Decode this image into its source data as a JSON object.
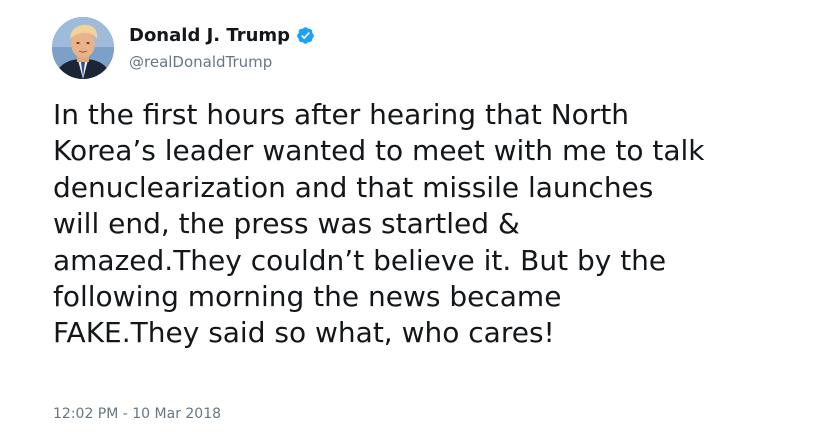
{
  "author": {
    "display_name": "Donald J. Trump",
    "handle": "@realDonaldTrump",
    "verified": true,
    "verified_icon": "verified-badge-icon",
    "avatar_icon": "profile-photo"
  },
  "tweet": {
    "lines": [
      "In the first hours after hearing that North",
      "Korea’s leader wanted to meet with me to talk",
      "denuclearization and that missile launches",
      "will end, the press was startled &",
      "amazed.They couldn’t believe it. But by the",
      "following morning the news became",
      "FAKE.They said so what, who cares!"
    ],
    "timestamp": "12:02 PM - 10 Mar 2018"
  },
  "colors": {
    "text": "#14171a",
    "secondary_text": "#657786",
    "verified_blue": "#1da1f2",
    "background": "#ffffff"
  }
}
